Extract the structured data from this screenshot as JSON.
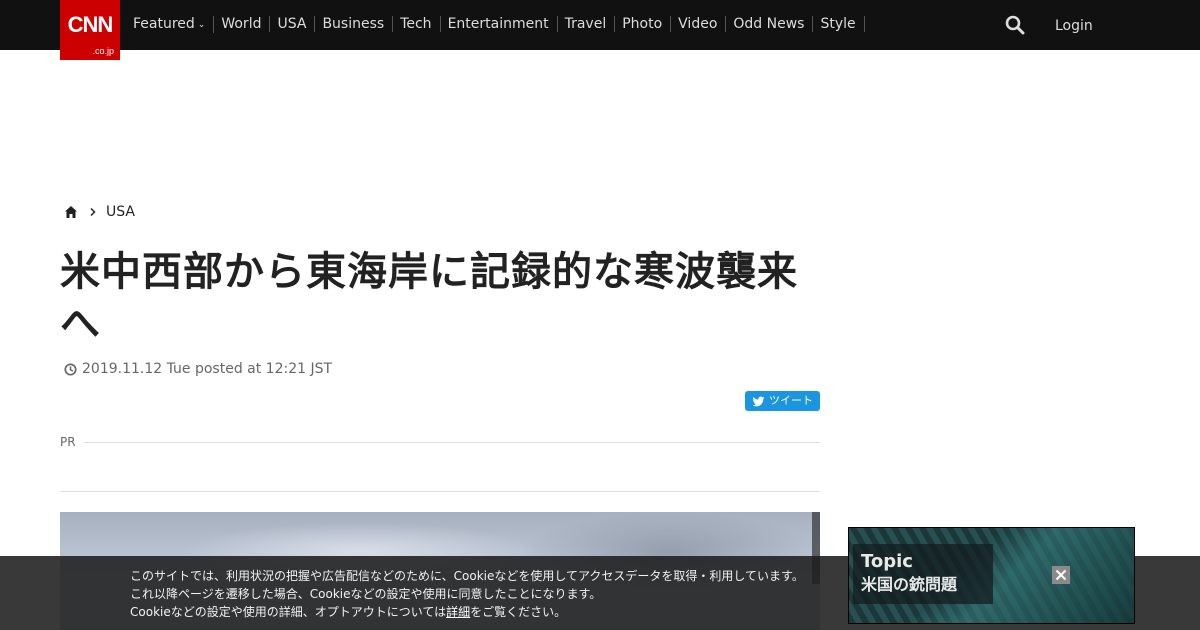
{
  "header": {
    "logo": {
      "wordmark": "CNN",
      "domain": ".co.jp"
    },
    "nav": [
      {
        "label": "Featured",
        "has_dropdown": true
      },
      {
        "label": "World"
      },
      {
        "label": "USA"
      },
      {
        "label": "Business"
      },
      {
        "label": "Tech"
      },
      {
        "label": "Entertainment"
      },
      {
        "label": "Travel"
      },
      {
        "label": "Photo"
      },
      {
        "label": "Video"
      },
      {
        "label": "Odd News"
      },
      {
        "label": "Style"
      }
    ],
    "search_icon": "search-icon",
    "login_label": "Login"
  },
  "breadcrumb": {
    "home_icon": "home-icon",
    "items": [
      "USA"
    ]
  },
  "article": {
    "headline": "米中西部から東海岸に記録的な寒波襲来へ",
    "posted": "2019.11.12 Tue posted at 12:21 JST",
    "tweet_label": "ツイート",
    "pr_label": "PR"
  },
  "cookie_banner": {
    "line1": "このサイトでは、利用状況の把握や広告配信などのために、Cookieなどを使用してアクセスデータを取得・利用しています。",
    "line2": "これ以降ページを遷移した場合、Cookieなどの設定や使用に同意したことになります。",
    "line3_before": "Cookieなどの設定や使用の詳細、オプトアウトについては",
    "line3_link": "詳細",
    "line3_after": "をご覧ください。"
  },
  "topic_ad": {
    "title": "Topic",
    "subtitle": "米国の銃問題"
  },
  "colors": {
    "brand_red": "#cc0000",
    "topbar": "#111111",
    "tweet_blue": "#1b95e0"
  }
}
